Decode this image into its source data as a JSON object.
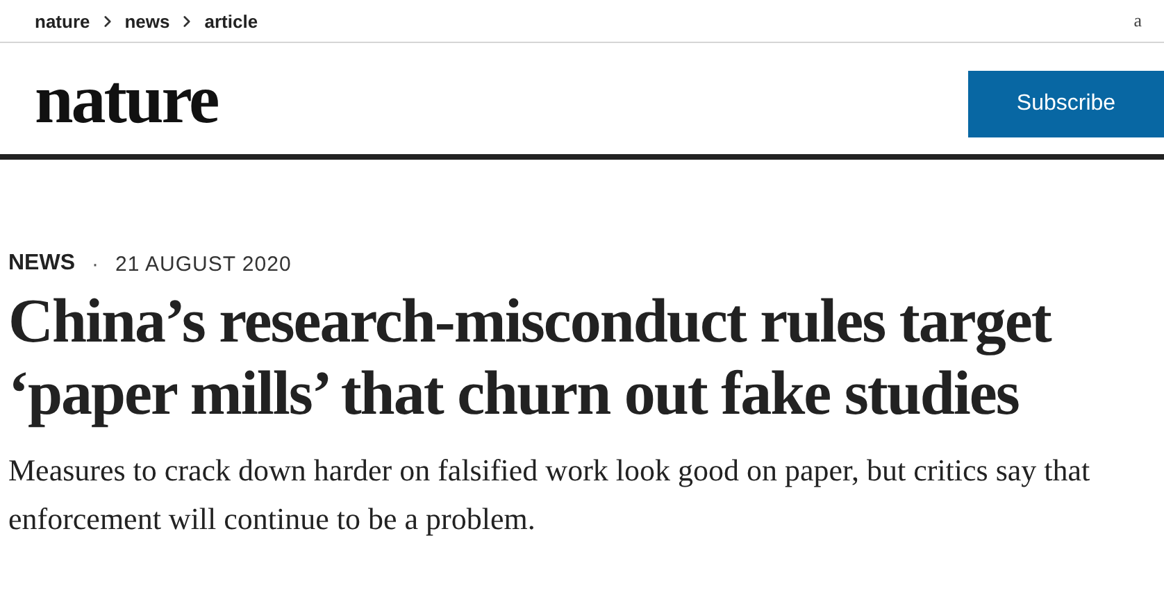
{
  "breadcrumb": [
    "nature",
    "news",
    "article"
  ],
  "corner_text": "a",
  "logo": "nature",
  "subscribe_button": "Subscribe",
  "article": {
    "type": "NEWS",
    "separator": "·",
    "date": "21 AUGUST 2020",
    "headline": "China’s research-misconduct rules target ‘paper mills’ that churn out fake studies",
    "standfirst": "Measures to crack down harder on falsified work look good on paper, but critics say that enforcement will continue to be a problem."
  }
}
